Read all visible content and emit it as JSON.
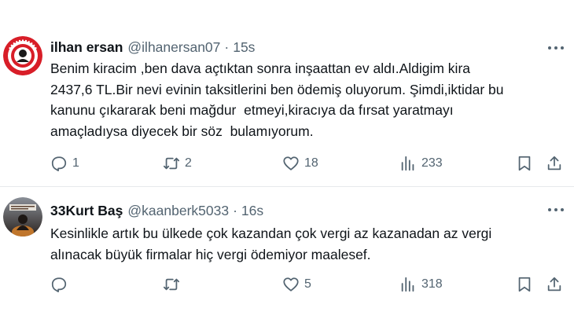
{
  "tweets": [
    {
      "display_name": "ilhan ersan",
      "handle": "@ilhanersan07",
      "separator": "·",
      "time": "15s",
      "text": "Benim kiracim ,ben dava açtıktan sonra inşaattan ev aldı.Aldigim kira\n2437,6 TL.Bir nevi evinin taksitlerini ben ödemiş oluyorum. Şimdi,iktidar bu\nkanunu çıkararak beni mağdur  etmeyi,kiracıya da fırsat yaratmayı\namaçladıysa diyecek bir söz  bulamıyorum.",
      "reply_count": "1",
      "retweet_count": "2",
      "like_count": "18",
      "view_count": "233"
    },
    {
      "display_name": "33Kurt Baş",
      "handle": "@kaanberk5033",
      "separator": "·",
      "time": "16s",
      "text": "Kesinlikle artık bu ülkede çok kazandan çok vergi az kazanadan az vergi\nalınacak büyük firmalar hiç vergi ödemiyor maalesef.",
      "reply_count": "",
      "retweet_count": "",
      "like_count": "5",
      "view_count": "318"
    }
  ],
  "colors": {
    "text": "#0f1419",
    "secondary": "#536471",
    "divider": "#e6e9ec",
    "avatar_red": "#d81e28"
  },
  "icons": [
    "reply-icon",
    "retweet-icon",
    "like-icon",
    "views-icon",
    "bookmark-icon",
    "share-icon",
    "more-icon"
  ]
}
